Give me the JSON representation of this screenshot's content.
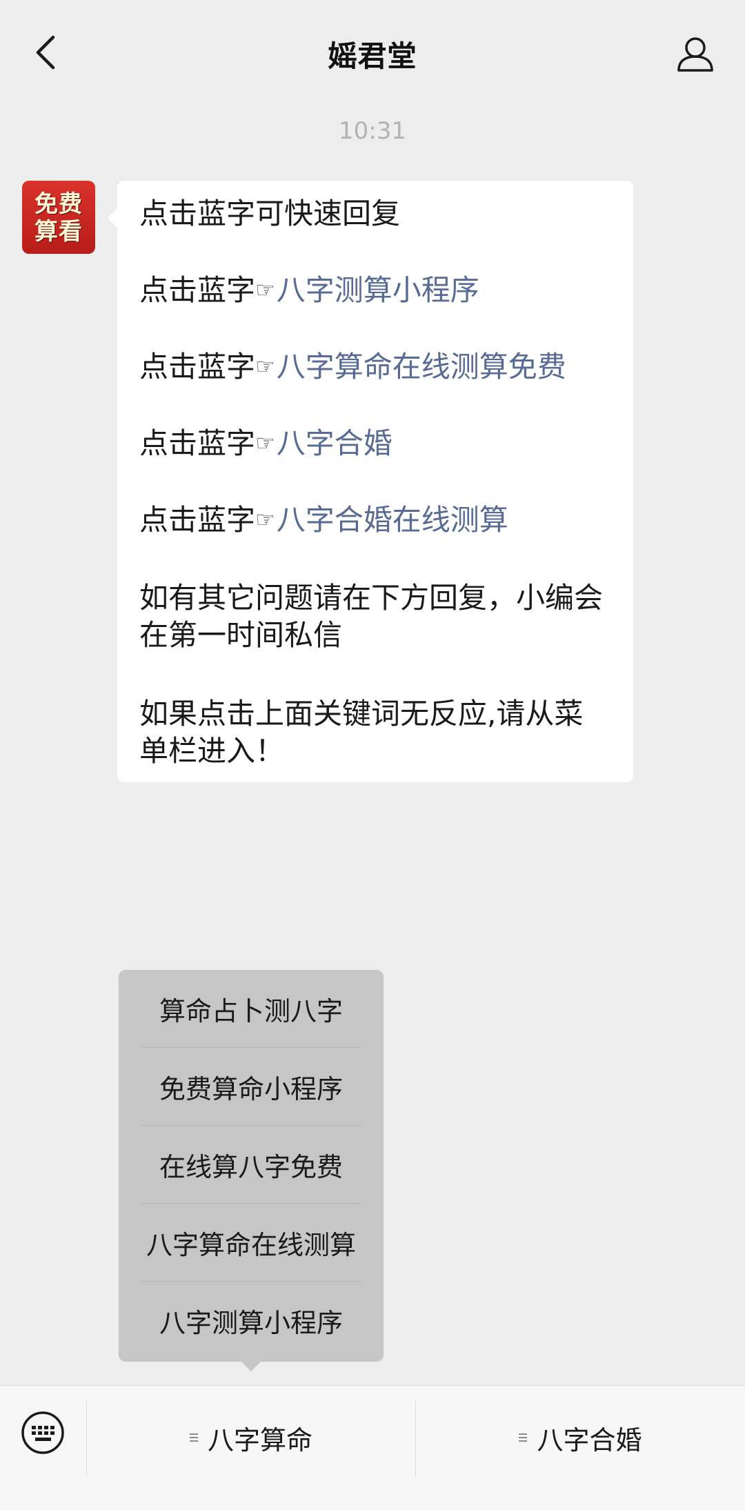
{
  "header": {
    "title": "媱君堂",
    "back_icon": "chevron-left-icon",
    "profile_icon": "person-icon"
  },
  "chat": {
    "timestamp": "10:31",
    "avatar": {
      "line1": "免费",
      "line2": "算看",
      "color": "#d9322b"
    },
    "message": {
      "intro": "点击蓝字可快速回复",
      "prefix": "点击蓝字",
      "links": [
        "八字测算小程序",
        "八字算命在线测算免费",
        "八字合婚",
        "八字合婚在线测算"
      ],
      "para1": "如有其它问题请在下方回复，小编会在第一时间私信",
      "para2": "如果点击上面关键词无反应,请从菜单栏进入！",
      "link_color": "#576b95"
    }
  },
  "popup_menu": {
    "items": [
      "算命占卜测八字",
      "免费算命小程序",
      "在线算八字免费",
      "八字算命在线测算",
      "八字测算小程序"
    ]
  },
  "bottom_bar": {
    "keyboard_icon": "keyboard-icon",
    "tabs": [
      "八字算命",
      "八字合婚"
    ]
  }
}
